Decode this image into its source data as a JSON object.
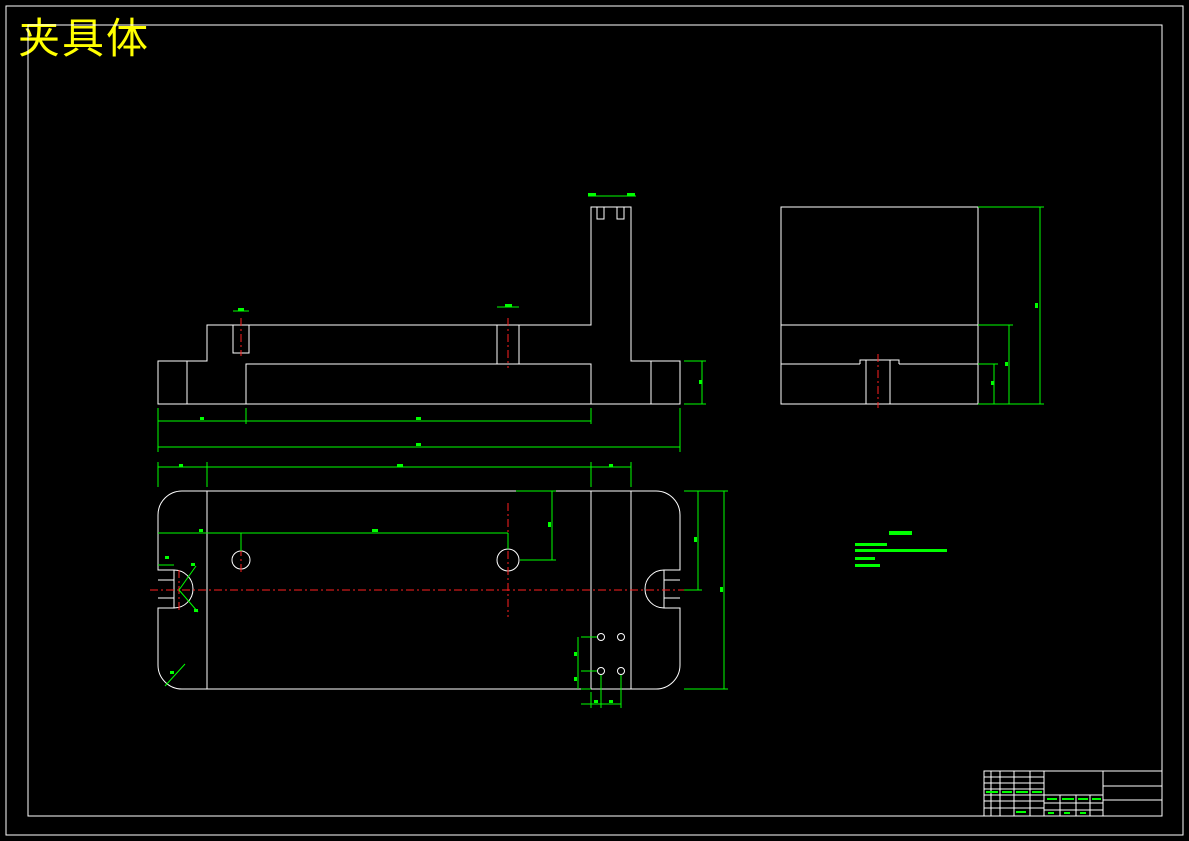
{
  "drawing": {
    "title": "夹具体",
    "colors": {
      "background": "#000000",
      "outline": "#ffffff",
      "dimension": "#00ff00",
      "centerline": "#ff2020",
      "hatch": "#00cccc",
      "title": "#ffff00"
    }
  }
}
